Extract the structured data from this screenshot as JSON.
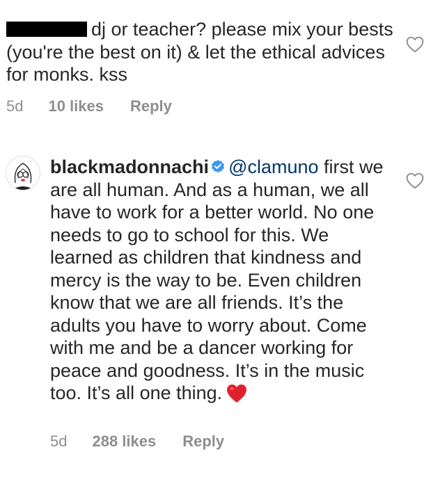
{
  "comments": [
    {
      "text": "dj or teacher? please mix your bests (you're the best on it) & let the ethical advices for monks. kss",
      "time": "5d",
      "likes": "10 likes",
      "reply": "Reply",
      "like_icon": "heart-outline-icon"
    },
    {
      "username": "blackmadonnachi",
      "verified_icon": "verified-badge-icon",
      "mention": "@clamuno",
      "text": " first we are all human. And as a human, we all have to work for a better world. No one needs to go to school for this. We learned as children that kindness and mercy is the way to be. Even children know that we are all friends. It’s the adults you have to worry about. Come with me and be a dancer working for peace and goodness. It’s in the music too. It’s all one thing.",
      "emoji": "red-heart-emoji",
      "time": "5d",
      "likes": "288 likes",
      "reply": "Reply",
      "like_icon": "heart-outline-icon"
    }
  ],
  "colors": {
    "text": "#262626",
    "meta": "#8e8e8e",
    "mention": "#00376b",
    "verified": "#3897f0",
    "heart": "#ed4956"
  }
}
